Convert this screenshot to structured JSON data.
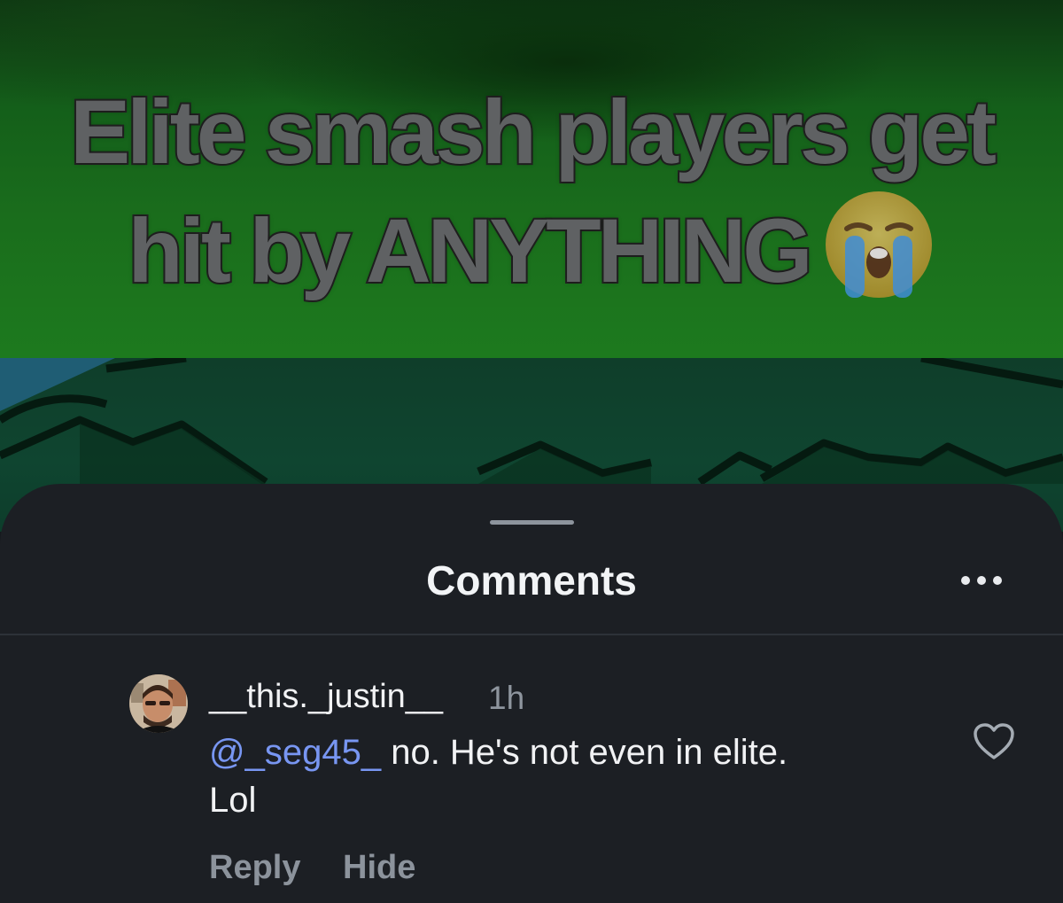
{
  "video": {
    "caption_line1": "Elite smash players get",
    "caption_line2": "hit by ANYTHING",
    "caption_emoji": "loudly-crying-face-emoji"
  },
  "sheet": {
    "title": "Comments",
    "more_icon": "more-horizontal-icon"
  },
  "comment": {
    "username": "__this._justin__",
    "timestamp": "1h",
    "mention": "@_seg45_",
    "text_line1": " no. He's not even in elite.",
    "text_line2": "Lol",
    "like_icon": "heart-outline-icon",
    "reply_label": "Reply",
    "hide_label": "Hide"
  },
  "colors": {
    "sheet_background": "#1c1f24",
    "mention": "#7896f2",
    "secondary_text": "#8c939c",
    "video_green": "#1d7a1e"
  }
}
